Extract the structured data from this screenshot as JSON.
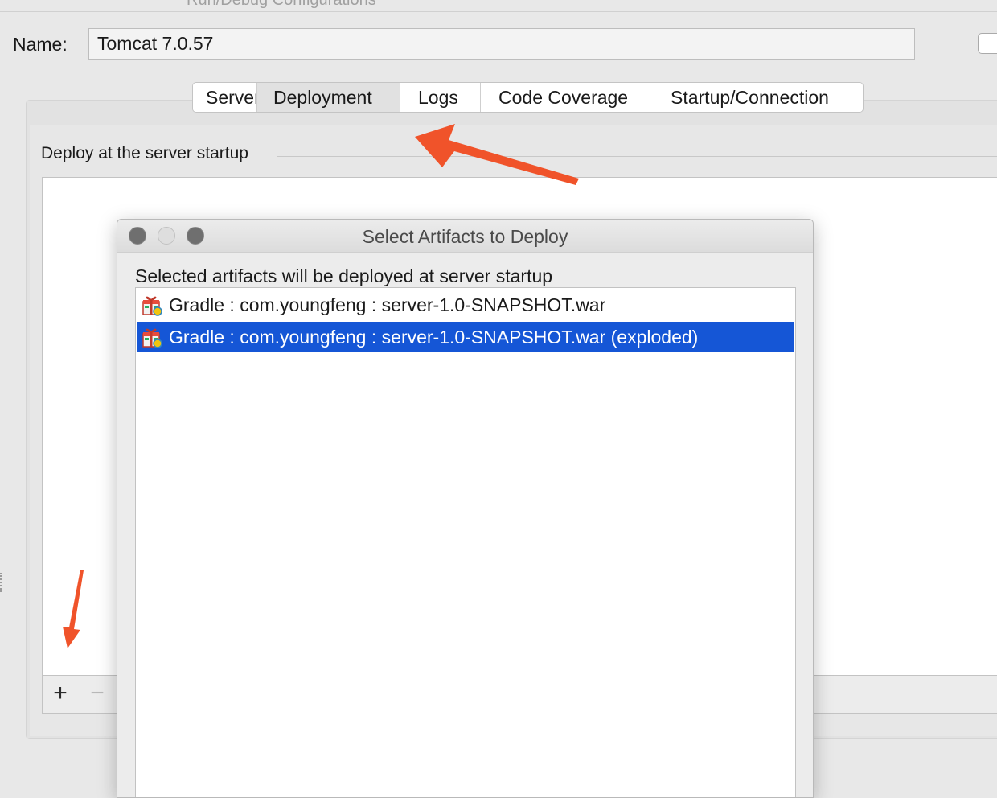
{
  "window": {
    "title": "Run/Debug Configurations"
  },
  "config": {
    "name_label": "Name:",
    "name_value": "Tomcat 7.0.57"
  },
  "tabs": [
    {
      "label": "Server",
      "active": false
    },
    {
      "label": "Deployment",
      "active": true
    },
    {
      "label": "Logs",
      "active": false
    },
    {
      "label": "Code Coverage",
      "active": false
    },
    {
      "label": "Startup/Connection",
      "active": false
    }
  ],
  "deployment": {
    "section_title": "Deploy at the server startup",
    "toolbar": {
      "add_label": "+",
      "remove_label": "−"
    }
  },
  "dialog": {
    "title": "Select Artifacts to Deploy",
    "description": "Selected artifacts will be deployed at server startup",
    "items": [
      {
        "label": "Gradle : com.youngfeng : server-1.0-SNAPSHOT.war",
        "selected": false,
        "icon": "artifact-gift-icon"
      },
      {
        "label": "Gradle : com.youngfeng : server-1.0-SNAPSHOT.war (exploded)",
        "selected": true,
        "icon": "artifact-gift-icon"
      }
    ]
  },
  "colors": {
    "selection": "#1556d6",
    "annotation_arrow": "#f0532a",
    "background": "#e8e8e8"
  }
}
